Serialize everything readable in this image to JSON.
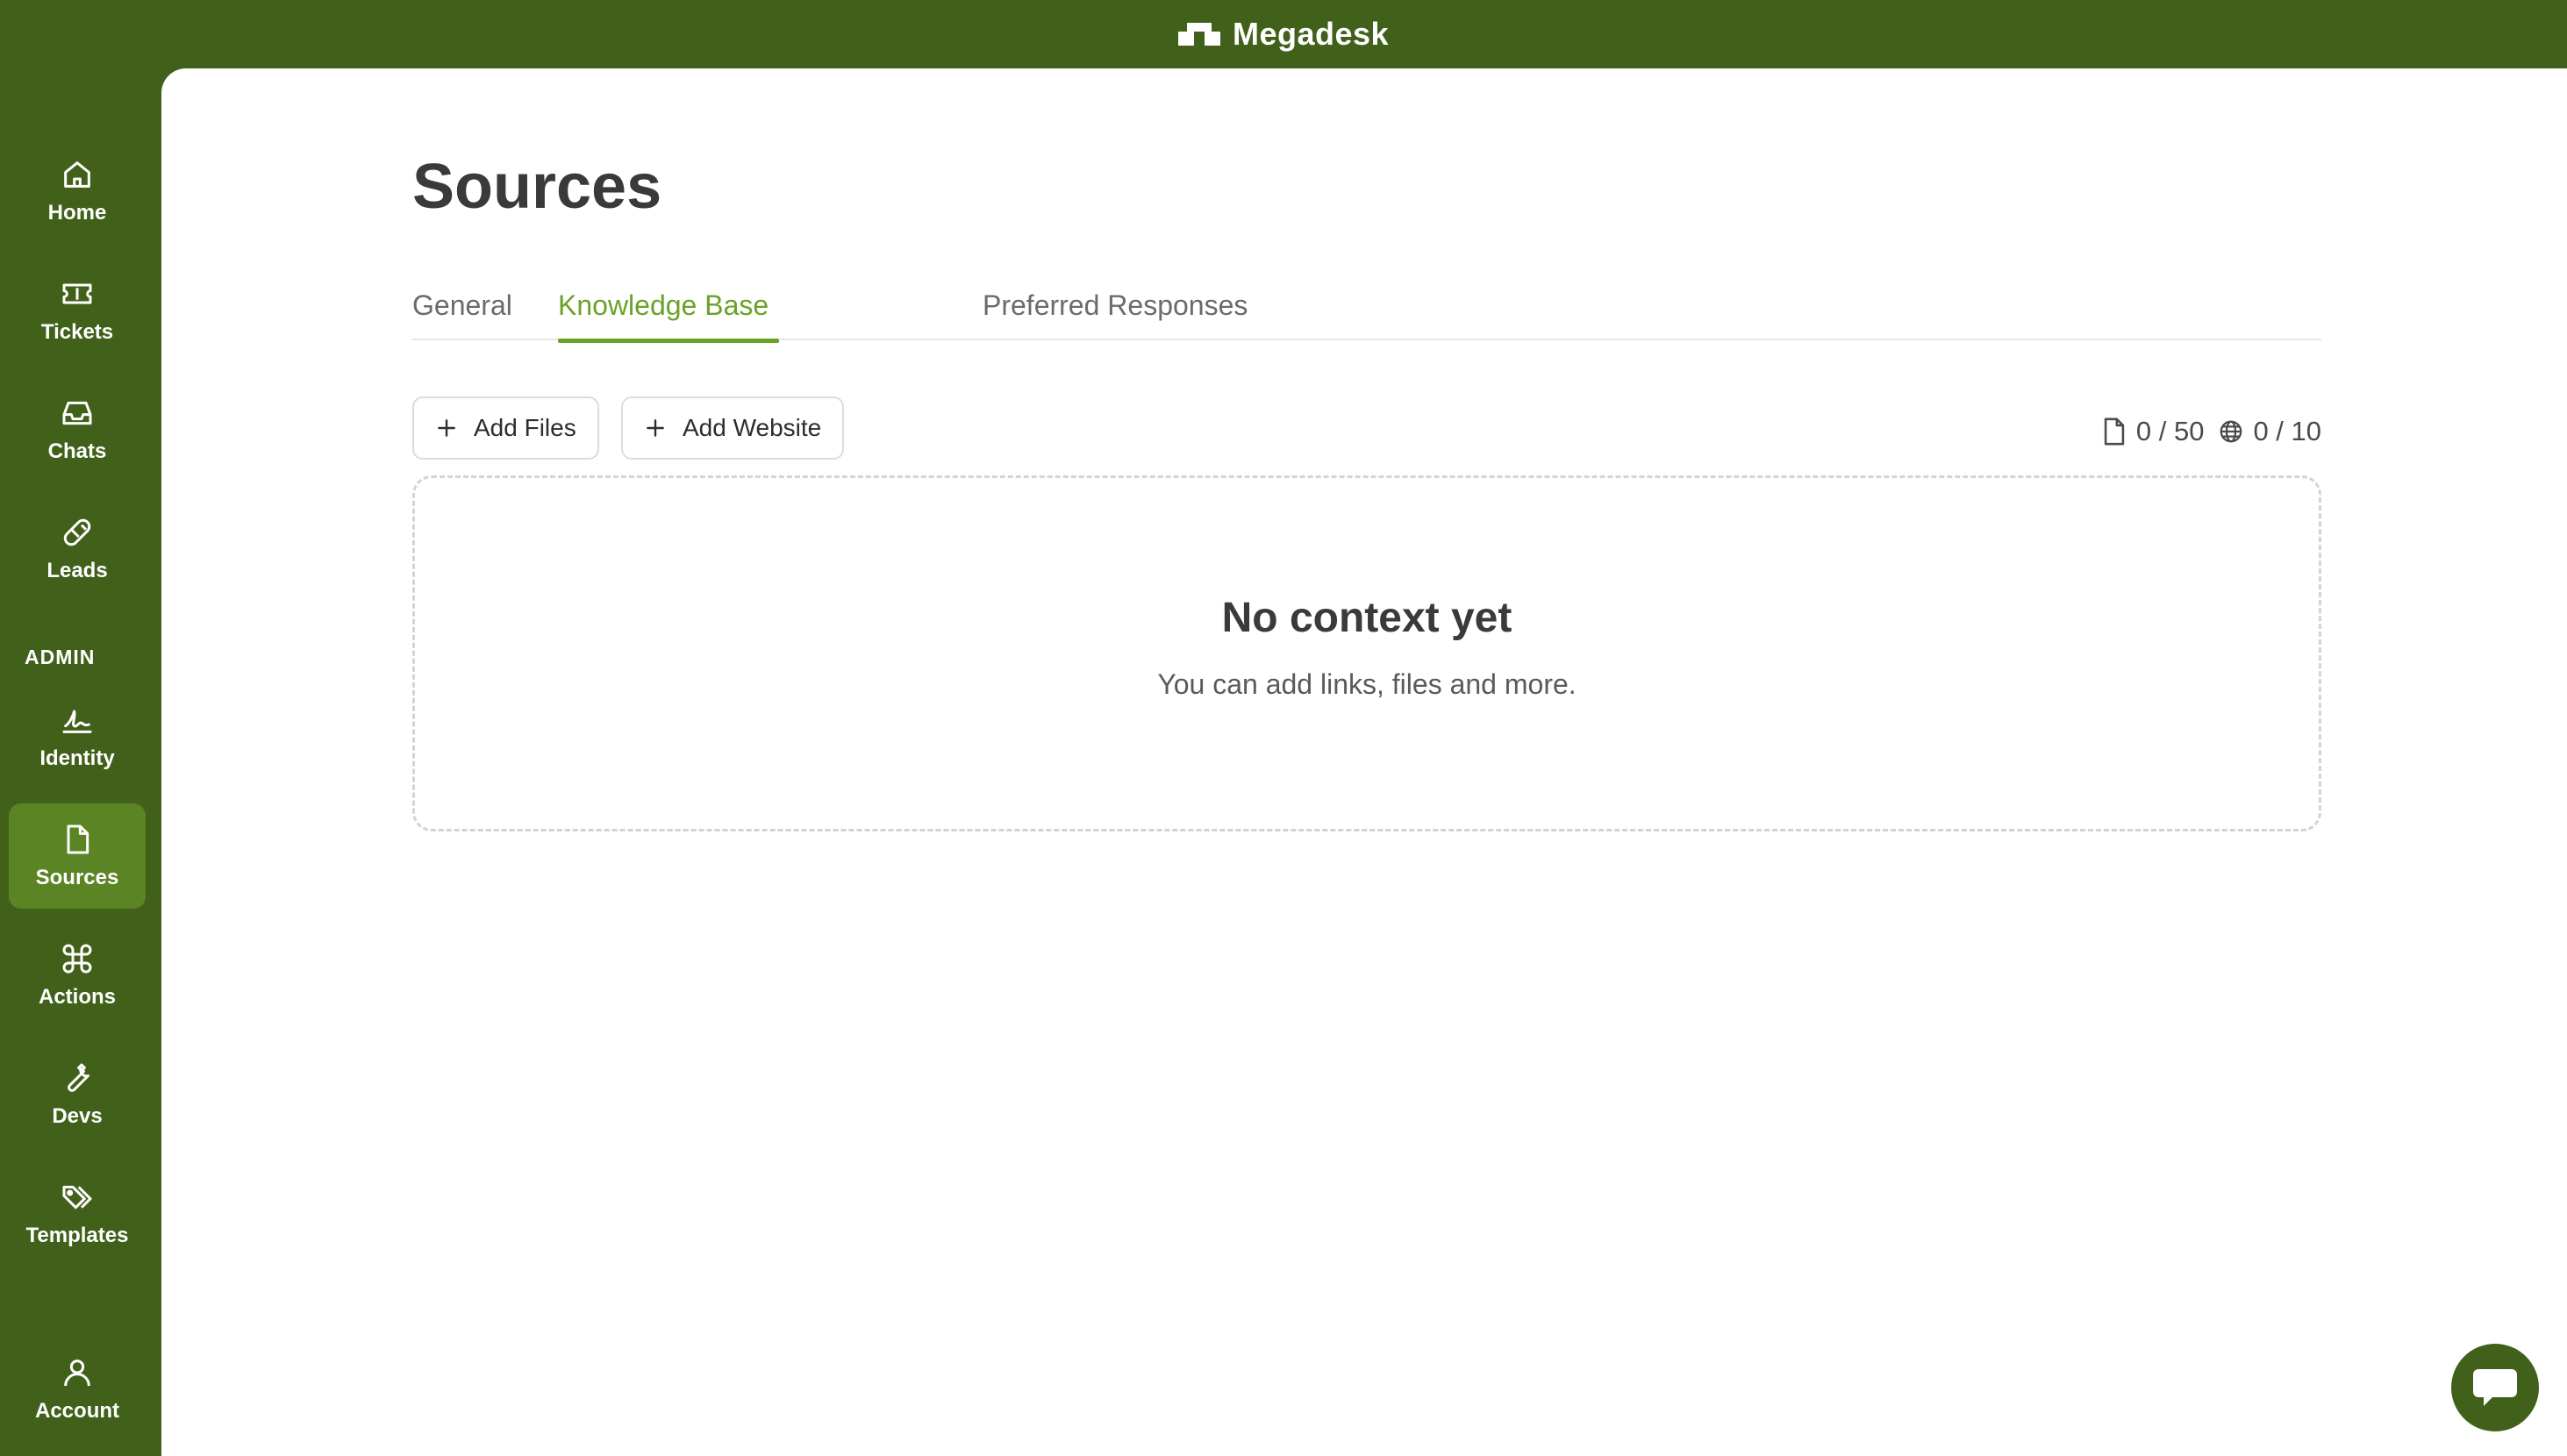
{
  "app": {
    "name": "Megadesk"
  },
  "sidebar": {
    "items": [
      {
        "label": "Home",
        "icon": "home-icon"
      },
      {
        "label": "Tickets",
        "icon": "ticket-icon"
      },
      {
        "label": "Chats",
        "icon": "inbox-icon"
      },
      {
        "label": "Leads",
        "icon": "magnet-icon"
      }
    ],
    "section_label": "ADMIN",
    "admin_items": [
      {
        "label": "Identity",
        "icon": "signature-icon"
      },
      {
        "label": "Sources",
        "icon": "file-icon",
        "active": true
      },
      {
        "label": "Actions",
        "icon": "command-icon"
      },
      {
        "label": "Devs",
        "icon": "wrench-icon"
      },
      {
        "label": "Templates",
        "icon": "tags-icon"
      }
    ],
    "account": {
      "label": "Account",
      "icon": "user-icon"
    }
  },
  "main": {
    "title": "Sources",
    "tabs": [
      {
        "label": "General",
        "active": false
      },
      {
        "label": "Knowledge Base",
        "active": true
      },
      {
        "label": "Preferred Responses",
        "active": false
      }
    ],
    "buttons": {
      "add_files": "Add Files",
      "add_website": "Add Website"
    },
    "counts": {
      "files": "0 / 50",
      "websites": "0 / 10"
    },
    "empty_state": {
      "title": "No context yet",
      "subtitle": "You can add links, files and more."
    }
  },
  "colors": {
    "brand": "#41601a",
    "active_nav": "#5b8424",
    "accent": "#6aa229"
  }
}
